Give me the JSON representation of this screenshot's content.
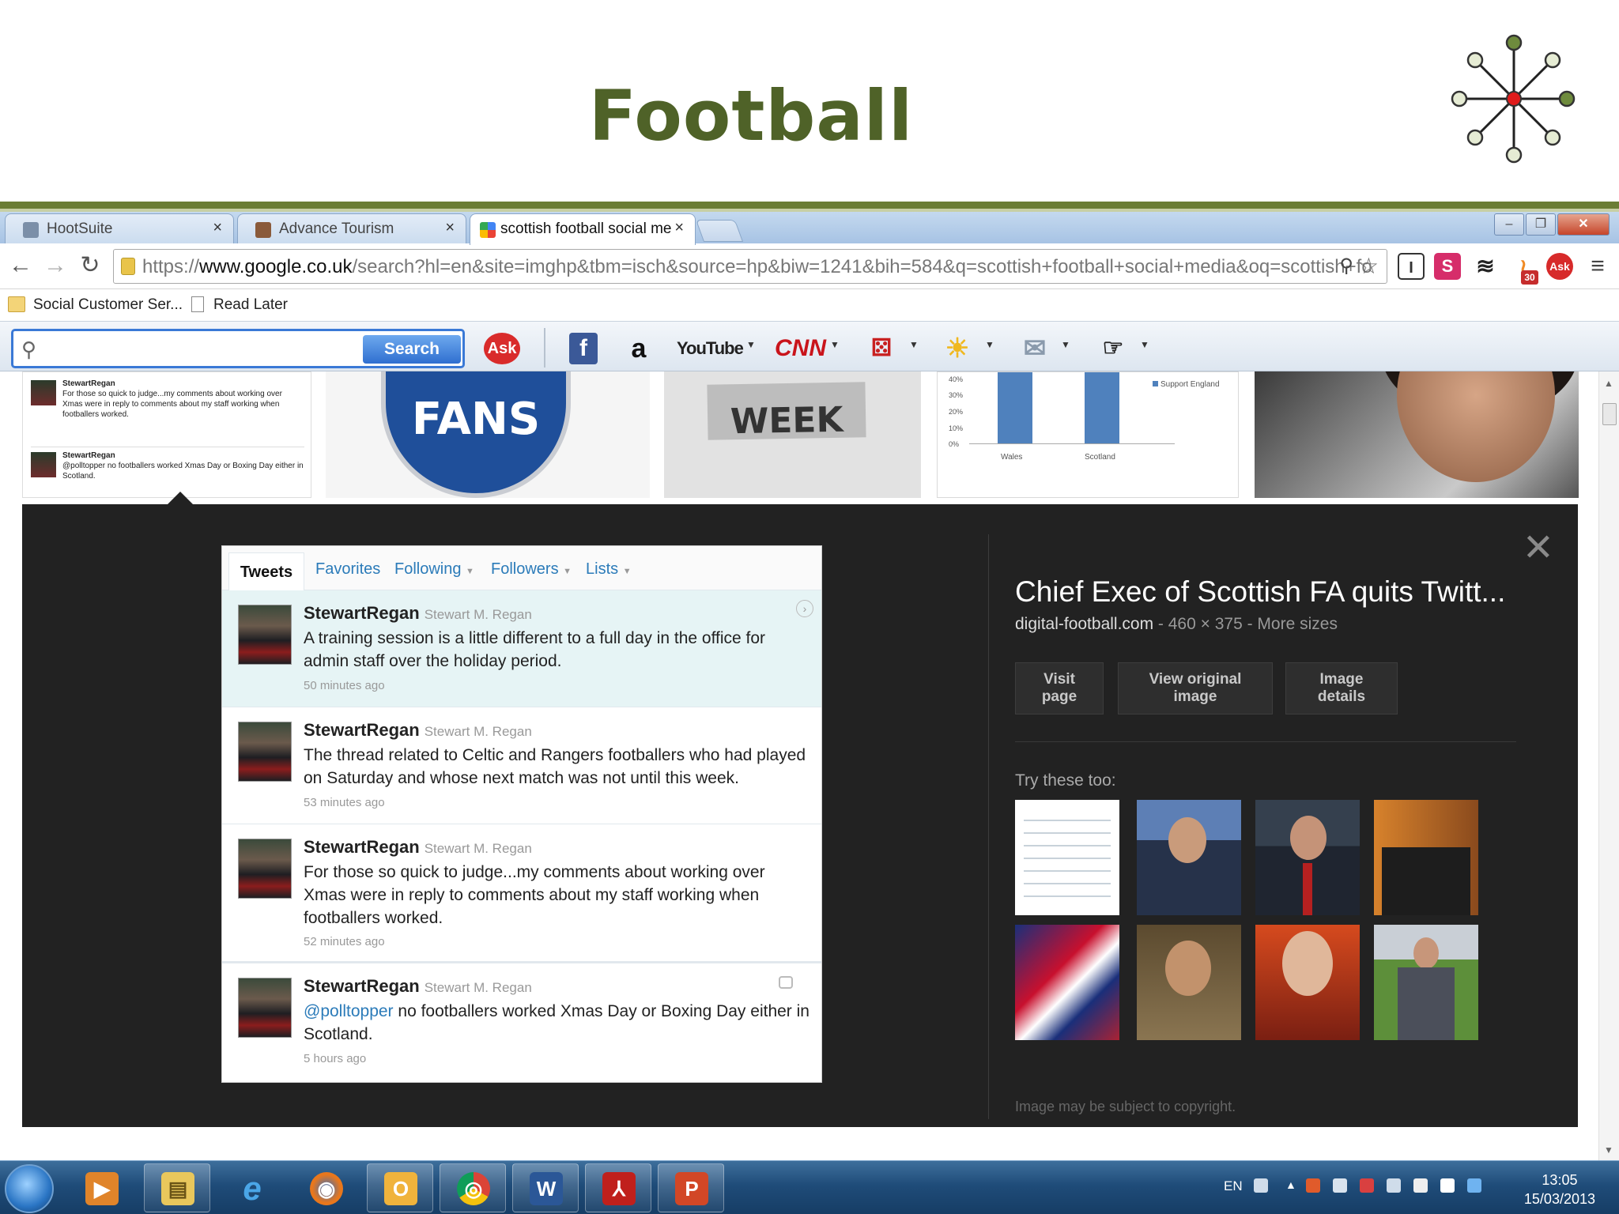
{
  "slide": {
    "title": "Football"
  },
  "browser": {
    "tabs": [
      {
        "label": "HootSuite"
      },
      {
        "label": "Advance Tourism"
      },
      {
        "label": "scottish football social me"
      }
    ],
    "window_controls": {
      "minimize": "–",
      "restore": "❐",
      "close": "✕"
    },
    "url": {
      "scheme": "https://",
      "host": "www.google.co.uk",
      "path": "/search?hl=en&site=imghp&tbm=isch&source=hp&biw=1241&bih=584&q=scottish+football+social+media&oq=scottish+fo"
    },
    "bookmarks": [
      {
        "label": "Social Customer Ser..."
      },
      {
        "label": "Read Later"
      }
    ],
    "toolbar": {
      "search_placeholder": "",
      "search_button": "Search",
      "ask_label": "Ask",
      "facebook_label": "f",
      "amazon_label": "a",
      "youtube_label": "YouTube",
      "cnn_label": "CNN",
      "ext_s_label": "S",
      "ext_i_label": "I",
      "rss_count": "30"
    }
  },
  "results_strip": {
    "mini_tweets": [
      {
        "name": "StewartRegan",
        "text": "For those so quick to judge...my comments about working over Xmas were in reply to comments about my staff working when footballers worked."
      },
      {
        "name": "StewartRegan",
        "text": "@polltopper no footballers worked Xmas Day or Boxing Day either in Scotland."
      }
    ],
    "shield_text": "FANS",
    "media_week_text": "WEEK",
    "chart_legend": "Support England",
    "chart_x_labels": [
      "Wales",
      "Scotland"
    ],
    "chart_y_labels": [
      "40%",
      "30%",
      "20%",
      "10%",
      "0%"
    ]
  },
  "preview": {
    "tabs": [
      {
        "label": "Tweets"
      },
      {
        "label": "Favorites"
      },
      {
        "label": "Following"
      },
      {
        "label": "Followers"
      },
      {
        "label": "Lists"
      }
    ],
    "tweets": [
      {
        "name": "StewartRegan",
        "handle": "Stewart M. Regan",
        "mention": "",
        "text": "A training session is a little different to a full day in the office for admin staff over the holiday period.",
        "time": "50 minutes ago"
      },
      {
        "name": "StewartRegan",
        "handle": "Stewart M. Regan",
        "mention": "",
        "text": "The thread related to Celtic and Rangers footballers who had played on Saturday and whose next match was not until this week.",
        "time": "53 minutes ago"
      },
      {
        "name": "StewartRegan",
        "handle": "Stewart M. Regan",
        "mention": "",
        "text": "For those so quick to judge...my comments about working over Xmas were in reply to comments about my staff working when footballers worked.",
        "time": "52 minutes ago"
      },
      {
        "name": "StewartRegan",
        "handle": "Stewart M. Regan",
        "mention": "@polltopper",
        "text": " no footballers worked Xmas Day or Boxing Day either in Scotland.",
        "time": "5 hours ago"
      }
    ],
    "result_title": "Chief Exec of Scottish FA quits Twitt...",
    "result_source": "digital-football.com",
    "result_meta": " - 460 × 375 - More sizes",
    "buttons": {
      "visit_line1": "Visit",
      "visit_line2": "page",
      "original_line1": "View original",
      "original_line2": "image",
      "details_line1": "Image",
      "details_line2": "details"
    },
    "try_label": "Try these too:",
    "copyright": "Image may be subject to copyright.",
    "close_glyph": "✕"
  },
  "taskbar": {
    "apps": [
      {
        "icon": "media-player-icon",
        "label": "▶"
      },
      {
        "icon": "file-explorer-icon",
        "label": "▤"
      },
      {
        "icon": "internet-explorer-icon",
        "label": "e"
      },
      {
        "icon": "firefox-icon",
        "label": "◉"
      },
      {
        "icon": "outlook-icon",
        "label": "O"
      },
      {
        "icon": "chrome-icon",
        "label": "◎"
      },
      {
        "icon": "word-icon",
        "label": "W"
      },
      {
        "icon": "acrobat-icon",
        "label": "⅄"
      },
      {
        "icon": "powerpoint-icon",
        "label": "P"
      }
    ],
    "language": "EN",
    "time": "13:05",
    "date": "15/03/2013"
  },
  "colors": {
    "title_green": "#4f6228",
    "twitter_link": "#2b7bb9",
    "preview_bg": "#222222"
  }
}
